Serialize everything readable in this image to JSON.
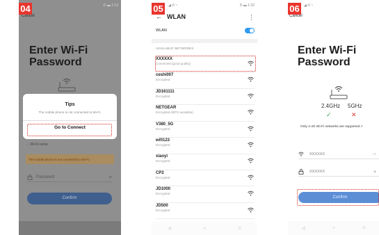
{
  "steps": [
    "04",
    "05",
    "06"
  ],
  "accent_color": "#e8352e",
  "screen1": {
    "status_right": "✆ ▬ 1:12",
    "cancel": "Cancel",
    "title": "Enter Wi-Fi Password",
    "ssid_placeholder": "Wi-Fi name",
    "warning": "The mobile phone is not connected to Wi-Fi.",
    "password_placeholder": "Password",
    "confirm": "Confirm",
    "dialog": {
      "title": "Tips",
      "message": "The mobile phone is not connected to Wi-Fi.",
      "action": "Go to Connect"
    }
  },
  "screen2": {
    "status_left": "◢ ✆ ⁿ",
    "status_right": "⏱ ▬ 1:32",
    "title": "WLAN",
    "wlan_label": "WLAN",
    "available_label": "AVAILABLE NETWORKS",
    "networks": [
      {
        "name": "XXXXXX",
        "status": "Connected (good quality)"
      },
      {
        "name": "ceshi007",
        "status": "Encrypted"
      },
      {
        "name": "JD161111",
        "status": "Encrypted"
      },
      {
        "name": "NETGEAR",
        "status": "Encrypted (WPS available)"
      },
      {
        "name": "V380_5G",
        "status": "Encrypted"
      },
      {
        "name": "wifi123",
        "status": "Encrypted"
      },
      {
        "name": "xiaoyi",
        "status": "Encrypted"
      },
      {
        "name": "CP2",
        "status": "Encrypted"
      },
      {
        "name": "JD1000",
        "status": "Encrypted"
      },
      {
        "name": "JD500",
        "status": "Encrypted"
      }
    ],
    "nav": [
      "◁",
      "○",
      "□"
    ]
  },
  "screen3": {
    "status_left": "◢ ✆ ⁿ",
    "cancel": "Cancel",
    "title": "Enter Wi-Fi Password",
    "band_24": "2.4GHz",
    "band_5": "5GHz",
    "note": "Only 2.4G Wi-Fi networks are supported >",
    "ssid_value": "XXXXXX",
    "ssid_hint": "ch",
    "password_value": "XXXXXX",
    "confirm": "Confirm",
    "nav": [
      "◁",
      "○",
      "□"
    ]
  }
}
